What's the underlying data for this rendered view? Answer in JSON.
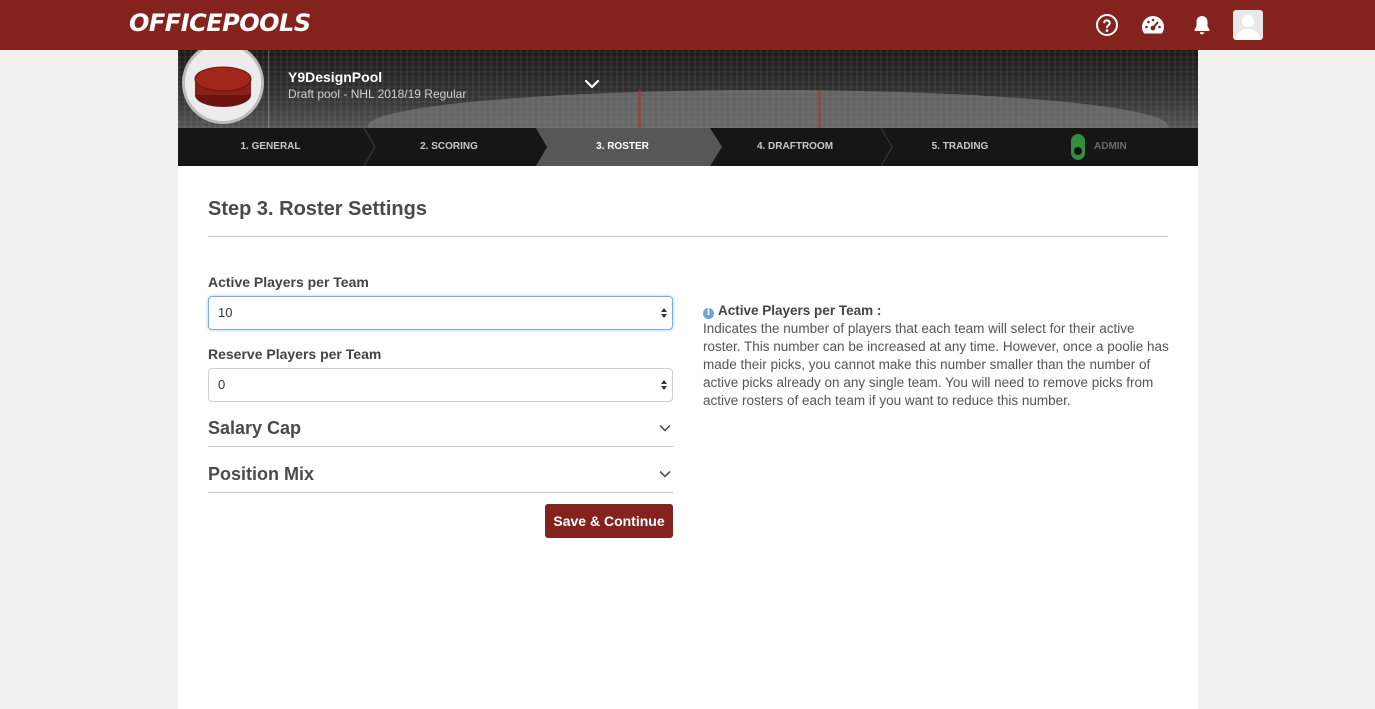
{
  "brand": {
    "logo": "OFFICEPOOLS",
    "accent": "#84231d"
  },
  "topbar_icons": [
    "help-icon",
    "dashboard-icon",
    "bell-icon",
    "avatar"
  ],
  "pool": {
    "name": "Y9DesignPool",
    "subtitle": "Draft pool - NHL 2018/19 Regular"
  },
  "steps": [
    {
      "label": "1. GENERAL",
      "active": false
    },
    {
      "label": "2. SCORING",
      "active": false
    },
    {
      "label": "3. ROSTER",
      "active": true
    },
    {
      "label": "4. DRAFTROOM",
      "active": false
    },
    {
      "label": "5. TRADING",
      "active": false
    }
  ],
  "admin": {
    "label": "ADMIN"
  },
  "page": {
    "title": "Step 3. Roster Settings"
  },
  "form": {
    "active_players": {
      "label": "Active Players per Team",
      "value": "10"
    },
    "reserve_players": {
      "label": "Reserve Players per Team",
      "value": "0"
    },
    "salary_cap": {
      "label": "Salary Cap"
    },
    "position_mix": {
      "label": "Position Mix"
    },
    "save_label": "Save & Continue"
  },
  "help": {
    "title": "Active Players per Team :",
    "body": "Indicates the number of players that each team will select for their active roster. This number can be increased at any time. However, once a poolie has made their picks, you cannot make this number smaller than the number of active picks already on any single team. You will need to remove picks from active rosters of each team if you want to reduce this number."
  }
}
